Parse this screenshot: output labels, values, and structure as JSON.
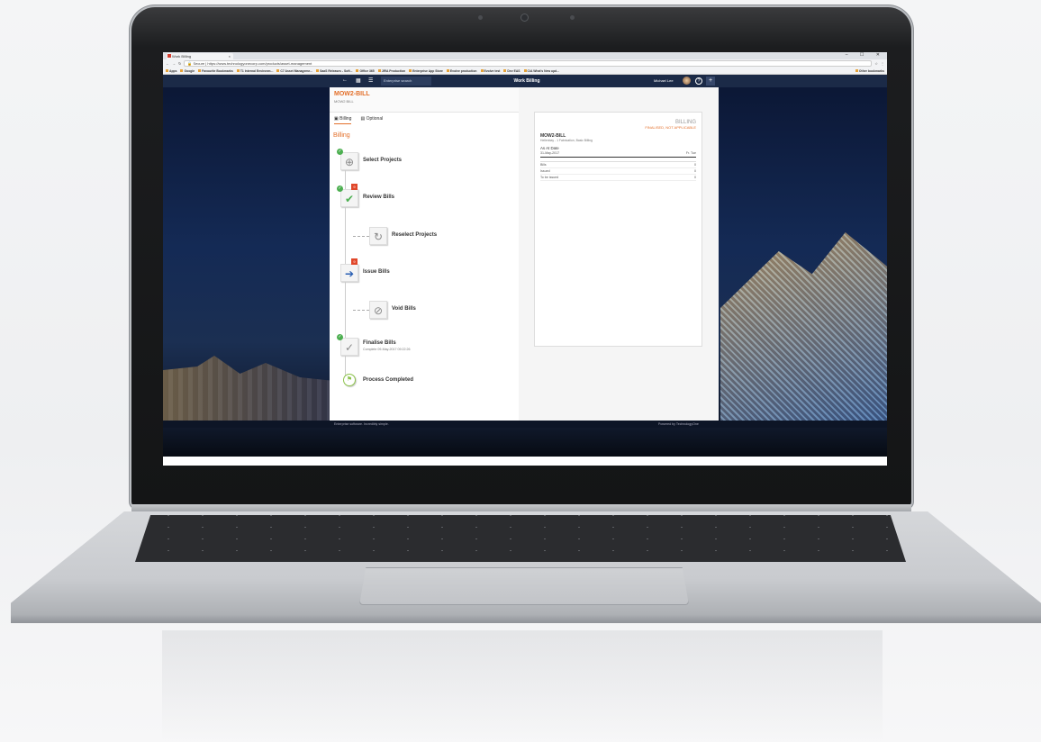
{
  "browser": {
    "tab_title": "Work Billing",
    "tab_close": "×",
    "window_controls": "– ☐ ✕",
    "secure_label": "Secure",
    "url": "https://www.technologyonecorp.com/products/asset-management",
    "bookmarks": [
      "Apps",
      "Google",
      "Favourite Bookmarks",
      "T1 Internal Environm...",
      "C7 Asset Manageme...",
      "SaaS Releases - Soft...",
      "Office 365",
      "JIRA Production",
      "Enterprise App Store",
      "Evolve production",
      "Evolve test",
      "Dev EAS",
      "CiA What's New upd..."
    ],
    "other_bookmarks": "Other bookmarks"
  },
  "topbar": {
    "search_placeholder": "Enterprise search",
    "title": "Work Billing",
    "user": "Michael Lee",
    "help": "?",
    "plus": "+"
  },
  "header": {
    "code": "MOW2-BILL",
    "subtitle": "MOW2 BILL"
  },
  "tabs": [
    {
      "label": "Billing"
    },
    {
      "label": "Optional"
    }
  ],
  "section_title": "Billing",
  "steps": [
    {
      "label": "Select Projects",
      "check": "✓"
    },
    {
      "label": "Review Bills",
      "check": "✓",
      "badge": "9"
    },
    {
      "label": "Reselect Projects"
    },
    {
      "label": "Issue Bills",
      "badge": "9"
    },
    {
      "label": "Void Bills"
    },
    {
      "label": "Finalise Bills",
      "check": "✓",
      "sub": "Complete 09-May-2017 09:22:26"
    },
    {
      "label": "Process Completed"
    }
  ],
  "preview": {
    "title": "BILLING",
    "status": "FINALISED, NOT APPLICABLE",
    "code": "MOW2-BILL",
    "code_sub": "Hellenbay - 1 Fabrication, Basic Billing",
    "as_at_label": "As At Date",
    "as_at_value": "31-May-2017",
    "as_at_extra": "Fr. Tue",
    "rows": [
      {
        "label": "Bills",
        "value": "0"
      },
      {
        "label": "Issued",
        "value": "0"
      },
      {
        "label": "To be issued",
        "value": "0"
      }
    ]
  },
  "footer": {
    "left": "Enterprise software. Incredibly simple.",
    "right": "Powered by TechnologyOne"
  }
}
